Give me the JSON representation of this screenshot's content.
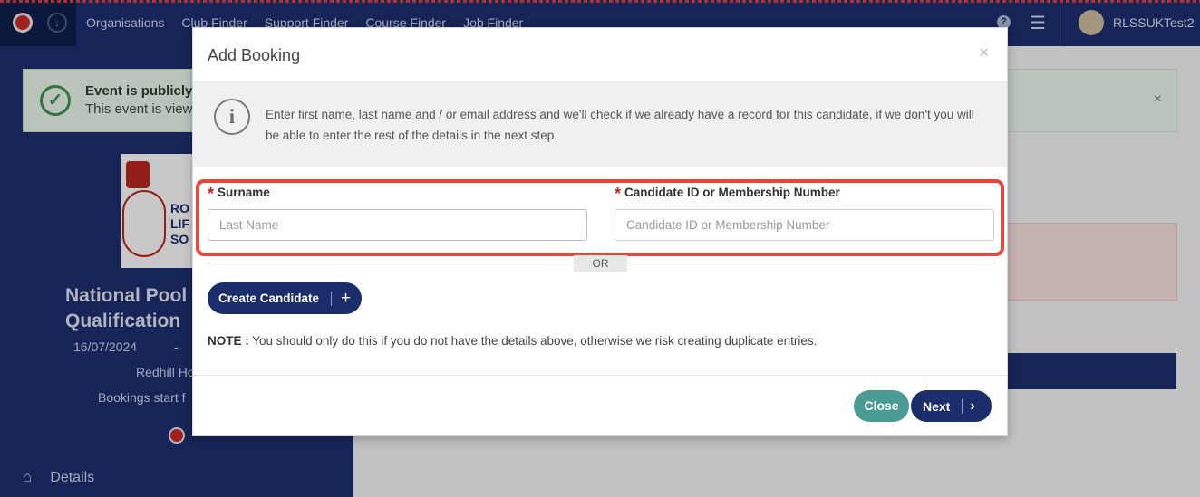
{
  "nav": {
    "links": [
      "Organisations",
      "Club Finder",
      "Support Finder",
      "Course Finder",
      "Job Finder"
    ],
    "user": "RLSSUKTest2",
    "icons": {
      "logo": "rlss-logo-icon",
      "download": "download-icon",
      "help": "help-icon",
      "menu": "hamburger-menu-icon"
    }
  },
  "background": {
    "alert_title": "Event is publicly",
    "alert_text": "This event is view",
    "event_title_line1": "National Pool",
    "event_title_line2": "Qualification",
    "date": "16/07/2024",
    "date_sep": "-",
    "venue": "Redhill Ho",
    "bookings": "Bookings start f",
    "logo_text_1": "RO",
    "logo_text_2": "LIF",
    "logo_text_3": "SO",
    "nav_details": "Details"
  },
  "modal": {
    "title": "Add Booking",
    "close_glyph": "×",
    "info": "Enter first name, last name and / or email address and we'll check if we already have a record for this candidate, if we don't you will be able to enter the rest of the details in the next step.",
    "surname_label": "Surname",
    "surname_placeholder": "Last Name",
    "surname_value": "",
    "candidate_label": "Candidate ID or Membership Number",
    "candidate_placeholder": "Candidate ID or Membership Number",
    "candidate_value": "",
    "required_marker": "*",
    "or_text": "OR",
    "create_button": "Create Candidate",
    "note_label": "NOTE :",
    "note_text": "You should only do this if you do not have the details above, otherwise we risk creating duplicate entries.",
    "close_button": "Close",
    "next_button": "Next"
  },
  "colors": {
    "navy": "#1b2d6b",
    "teal": "#4a9a96",
    "highlight": "#e8453c",
    "required": "#b32a2a"
  }
}
